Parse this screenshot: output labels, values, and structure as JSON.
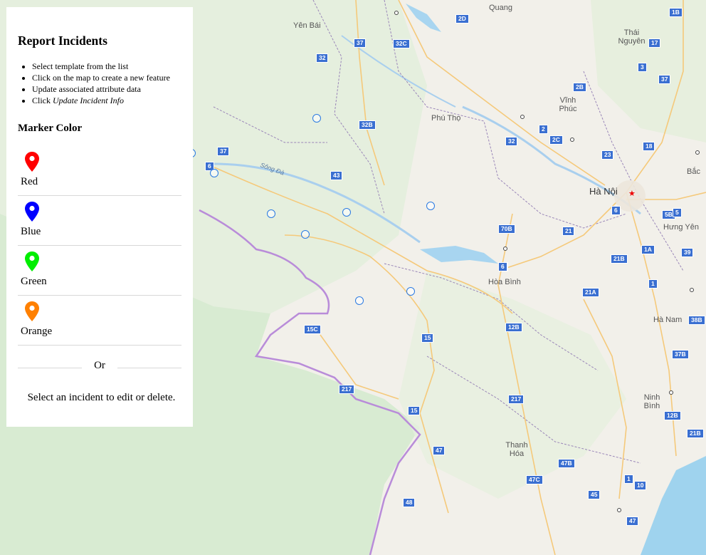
{
  "panel": {
    "title": "Report Incidents",
    "instructions": [
      "Select template from the list",
      "Click on the map to create a new feature",
      "Update associated attribute data"
    ],
    "instruction_click_prefix": "Click ",
    "instruction_click_em": "Update Incident Info",
    "marker_heading": "Marker Color",
    "templates": [
      {
        "label": "Red",
        "color": "#ff0000"
      },
      {
        "label": "Blue",
        "color": "#0000ff"
      },
      {
        "label": "Green",
        "color": "#00ee00"
      },
      {
        "label": "Orange",
        "color": "#ff8000"
      }
    ],
    "or_text": "Or",
    "select_text": "Select an incident to edit or delete."
  },
  "map": {
    "places": [
      "Yên Bái",
      "Quang",
      "Thái Nguyên",
      "Vĩnh Phúc",
      "Phú Thọ",
      "Hà Nội",
      "Bắc",
      "Hưng Yên",
      "Hòa Bình",
      "Hà Nam",
      "Ninh Bình",
      "Thanh Hóa"
    ],
    "river": "Sông Đà",
    "highways": [
      "1B",
      "2D",
      "37",
      "32C",
      "17",
      "32",
      "3",
      "37",
      "2B",
      "32B",
      "2",
      "2C",
      "18",
      "23",
      "32",
      "37",
      "6",
      "43",
      "6",
      "5B",
      "5",
      "70B",
      "21",
      "1A",
      "39",
      "6",
      "21B",
      "21A",
      "6",
      "1",
      "12B",
      "38B",
      "15C",
      "15",
      "37B",
      "217",
      "217",
      "12B",
      "15",
      "21B",
      "47",
      "47B",
      "47C",
      "1",
      "10",
      "48",
      "45",
      "47"
    ],
    "incidents": 10
  }
}
